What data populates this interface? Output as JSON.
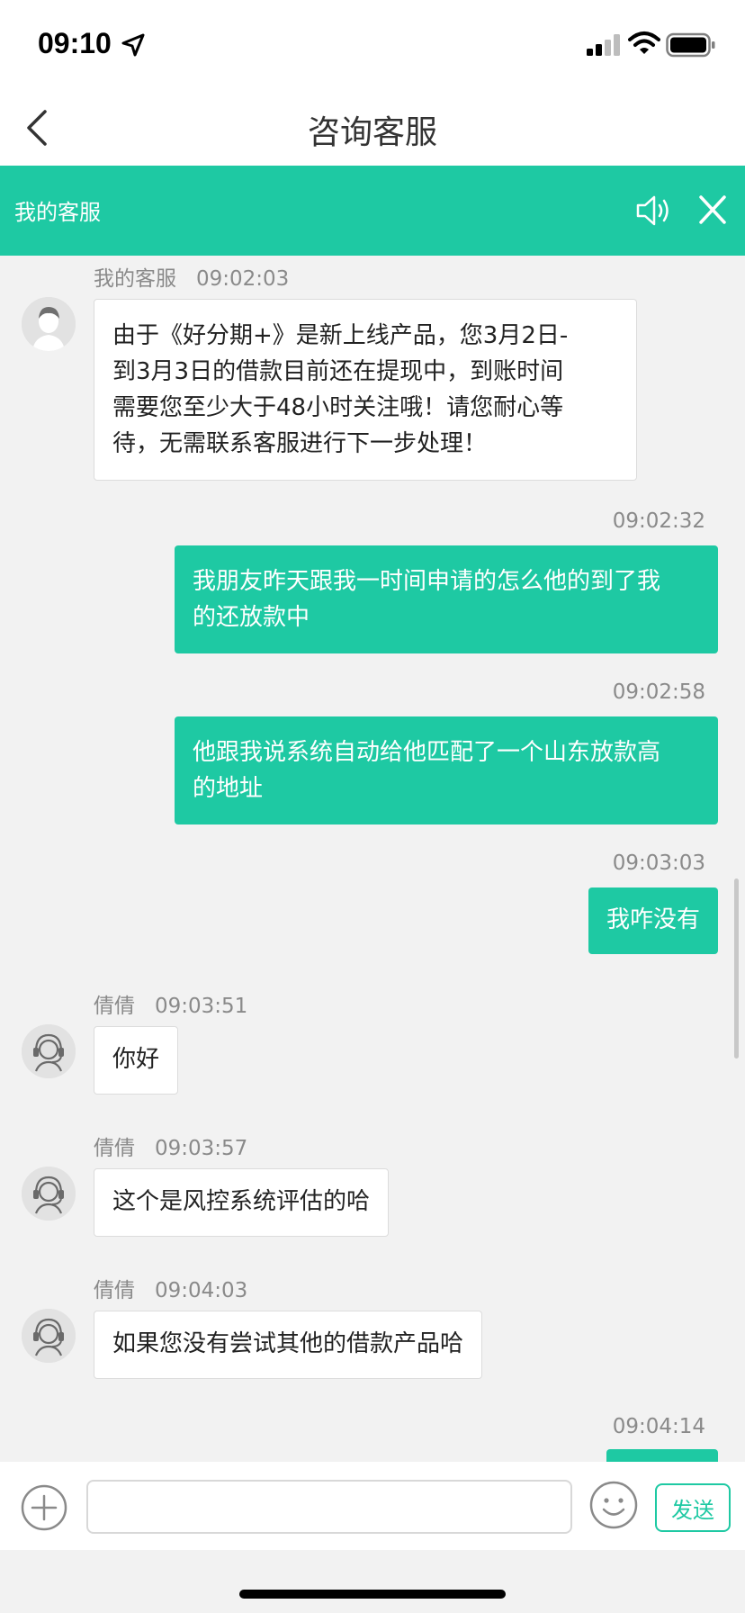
{
  "status": {
    "time": "09:10"
  },
  "nav": {
    "title": "咨询客服"
  },
  "agent_bar": {
    "title": "我的客服"
  },
  "messages": [
    {
      "side": "in",
      "sender": "我的客服",
      "time": "09:02:03",
      "avatar": "default-avatar-icon",
      "lines": [
        "由于《好分期+》是新上线产品，您3月2日-",
        "到3月3日的借款目前还在提现中，到账时间",
        "需要您至少大于48小时关注哦！请您耐心等",
        "待，无需联系客服进行下一步处理！"
      ]
    },
    {
      "side": "out",
      "time": "09:02:32",
      "lines": [
        "我朋友昨天跟我一时间申请的怎么他的到了我",
        "的还放款中"
      ]
    },
    {
      "side": "out",
      "time": "09:02:58",
      "lines": [
        "他跟我说系统自动给他匹配了一个山东放款高",
        "的地址"
      ]
    },
    {
      "side": "out",
      "time": "09:03:03",
      "lines": [
        "我咋没有"
      ]
    },
    {
      "side": "in",
      "sender": "倩倩",
      "time": "09:03:51",
      "avatar": "headset-agent-icon",
      "lines": [
        "你好"
      ]
    },
    {
      "side": "in",
      "sender": "倩倩",
      "time": "09:03:57",
      "avatar": "headset-agent-icon",
      "lines": [
        "这个是风控系统评估的哈"
      ]
    },
    {
      "side": "in",
      "sender": "倩倩",
      "time": "09:04:03",
      "avatar": "headset-agent-icon",
      "lines": [
        "如果您没有尝试其他的借款产品哈"
      ]
    },
    {
      "side": "out",
      "time": "09:04:14",
      "lines": [
        ""
      ]
    }
  ],
  "input": {
    "placeholder": "",
    "send_label": "发送"
  },
  "colors": {
    "accent": "#1ec9a3",
    "background": "#f2f2f2"
  }
}
